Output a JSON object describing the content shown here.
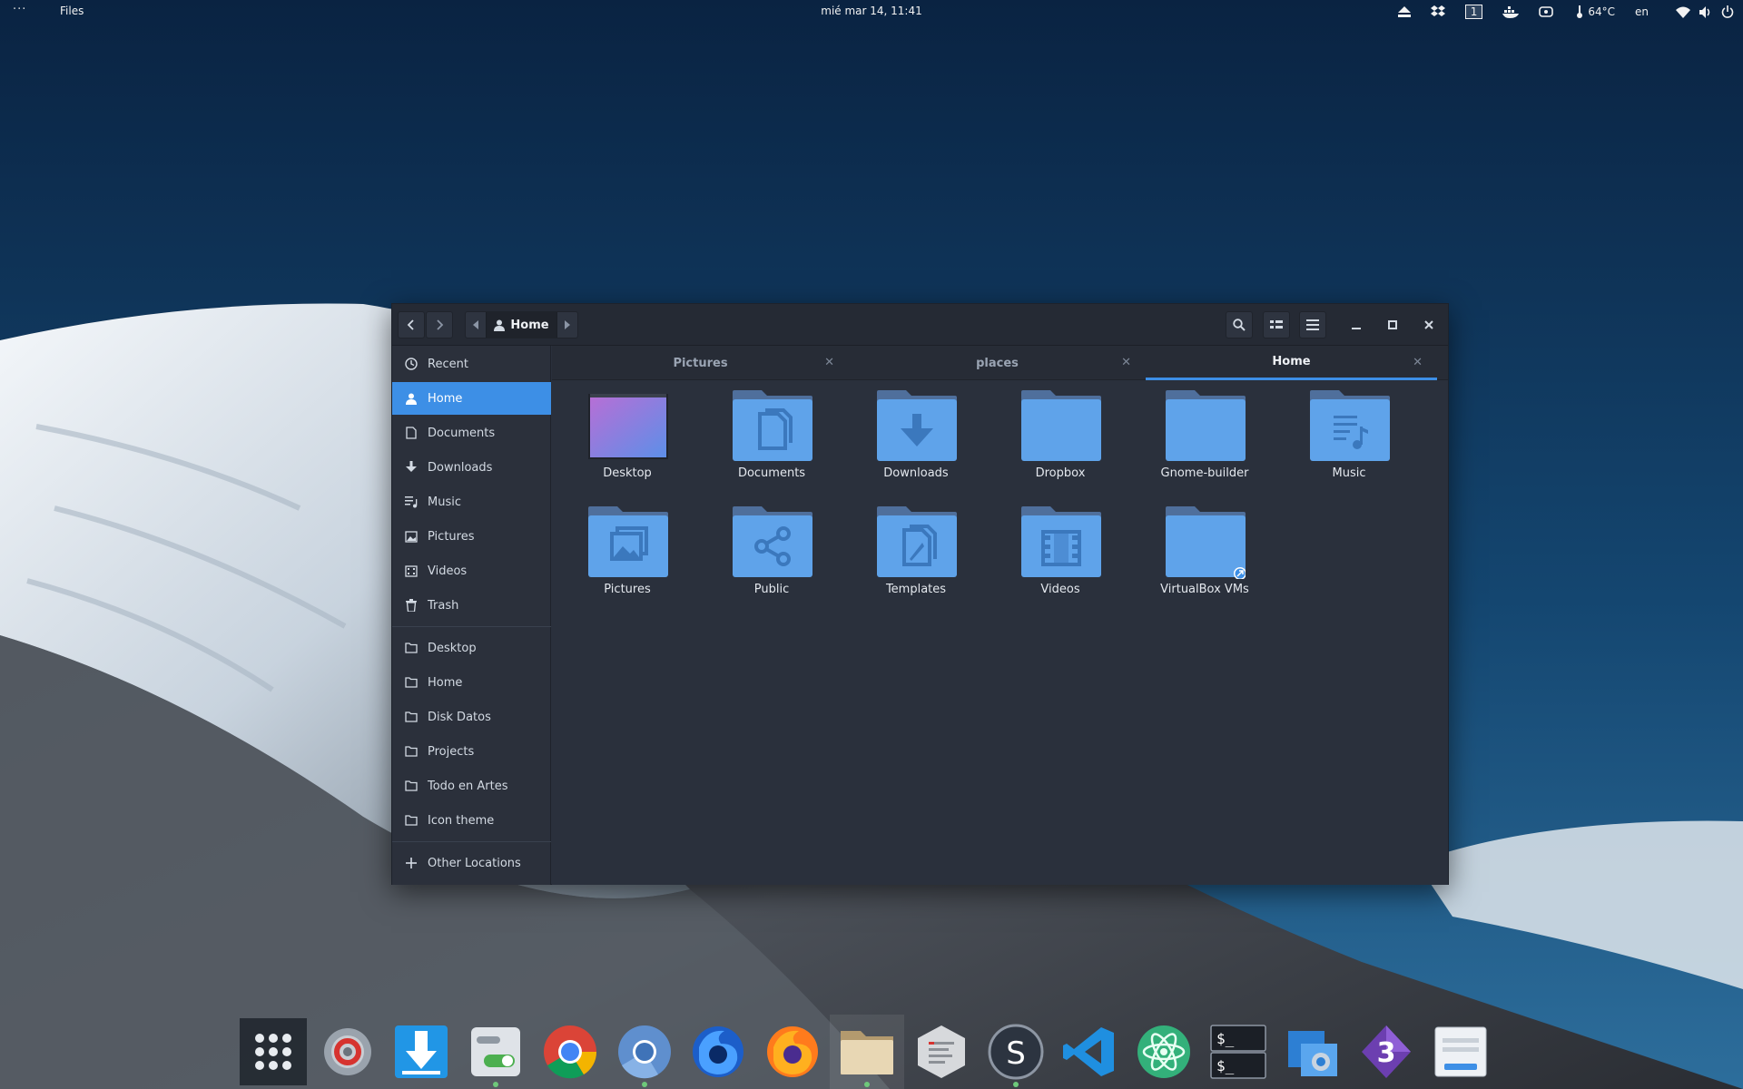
{
  "topbar": {
    "activities": "···",
    "app_name": "Files",
    "clock": "mié mar 14, 11:41",
    "workspace": "1",
    "temperature": "64°C",
    "language": "en"
  },
  "window": {
    "pathbar": {
      "current": "Home"
    },
    "sidebar": {
      "places": [
        {
          "label": "Recent",
          "icon": "clock-icon"
        },
        {
          "label": "Home",
          "icon": "home-icon",
          "active": true
        },
        {
          "label": "Documents",
          "icon": "document-icon"
        },
        {
          "label": "Downloads",
          "icon": "download-icon"
        },
        {
          "label": "Music",
          "icon": "music-icon"
        },
        {
          "label": "Pictures",
          "icon": "picture-icon"
        },
        {
          "label": "Videos",
          "icon": "video-icon"
        },
        {
          "label": "Trash",
          "icon": "trash-icon"
        }
      ],
      "bookmarks": [
        {
          "label": "Desktop",
          "icon": "folder-icon"
        },
        {
          "label": "Home",
          "icon": "folder-icon"
        },
        {
          "label": "Disk Datos",
          "icon": "folder-icon"
        },
        {
          "label": "Projects",
          "icon": "folder-icon"
        },
        {
          "label": "Todo en Artes",
          "icon": "folder-icon"
        },
        {
          "label": "Icon theme",
          "icon": "folder-icon"
        }
      ],
      "other": {
        "label": "Other Locations",
        "icon": "plus-icon"
      }
    },
    "tabs": [
      {
        "label": "Pictures",
        "active": false
      },
      {
        "label": "places",
        "active": false
      },
      {
        "label": "Home",
        "active": true
      }
    ],
    "items": [
      {
        "label": "Desktop",
        "glyph": "desktop"
      },
      {
        "label": "Documents",
        "glyph": "documents"
      },
      {
        "label": "Downloads",
        "glyph": "downloads"
      },
      {
        "label": "Dropbox",
        "glyph": "plain"
      },
      {
        "label": "Gnome-builder",
        "glyph": "plain"
      },
      {
        "label": "Music",
        "glyph": "music"
      },
      {
        "label": "Pictures",
        "glyph": "pictures"
      },
      {
        "label": "Public",
        "glyph": "share"
      },
      {
        "label": "Templates",
        "glyph": "templates"
      },
      {
        "label": "Videos",
        "glyph": "videos"
      },
      {
        "label": "VirtualBox VMs",
        "glyph": "link"
      }
    ]
  },
  "dock": {
    "apps": [
      {
        "name": "app-grid-icon",
        "running": false
      },
      {
        "name": "settings-icon",
        "running": false
      },
      {
        "name": "downloader-icon",
        "running": false
      },
      {
        "name": "tweaks-icon",
        "running": true
      },
      {
        "name": "chrome-icon",
        "running": false
      },
      {
        "name": "chromium-icon",
        "running": true
      },
      {
        "name": "firefox-dev-icon",
        "running": false
      },
      {
        "name": "firefox-icon",
        "running": false
      },
      {
        "name": "files-icon",
        "running": true
      },
      {
        "name": "text-editor-icon",
        "running": false
      },
      {
        "name": "simplenote-icon",
        "running": true
      },
      {
        "name": "vscode-icon",
        "running": false
      },
      {
        "name": "atom-icon",
        "running": false
      },
      {
        "name": "terminal-icon",
        "running": false
      },
      {
        "name": "screenshot-icon",
        "running": false
      },
      {
        "name": "builder-3-icon",
        "running": false
      },
      {
        "name": "dialog-app-icon",
        "running": false
      }
    ]
  },
  "colors": {
    "accent": "#3d8fe6",
    "folder": "#5fa3ea",
    "window_bg": "#2a303c"
  }
}
